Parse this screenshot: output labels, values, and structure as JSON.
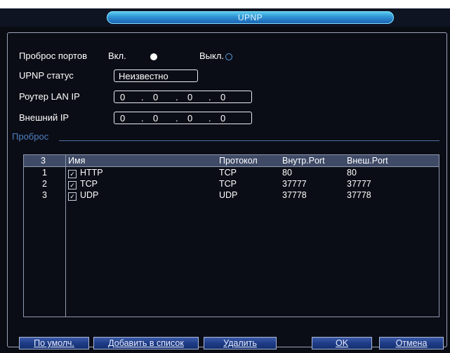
{
  "window": {
    "title": "UPNP"
  },
  "form": {
    "port_forward_label": "Проброс портов",
    "on_label": "Вкл.",
    "off_label": "Выкл.",
    "port_forward_enabled": true,
    "status_label": "UPNP статус",
    "status_value": "Неизвестно",
    "lan_ip_label": "Роутер LAN IP",
    "lan_ip": [
      "0",
      "0",
      "0",
      "0"
    ],
    "wan_ip_label": "Внешний IP",
    "wan_ip": [
      "0",
      "0",
      "0",
      "0"
    ]
  },
  "section_label": "Проброс",
  "table": {
    "count": "3",
    "columns": {
      "name": "Имя",
      "protocol": "Протокол",
      "internal_port": "Внутр.Port",
      "external_port": "Внеш.Port"
    },
    "rows": [
      {
        "index": "1",
        "name": "HTTP",
        "protocol": "TCP",
        "internal_port": "80",
        "external_port": "80",
        "checked": true
      },
      {
        "index": "2",
        "name": "TCP",
        "protocol": "TCP",
        "internal_port": "37777",
        "external_port": "37777",
        "checked": true
      },
      {
        "index": "3",
        "name": "UDP",
        "protocol": "UDP",
        "internal_port": "37778",
        "external_port": "37778",
        "checked": true
      }
    ]
  },
  "buttons": {
    "default": "По умолч.",
    "add": "Добавить в список",
    "delete": "Удалить",
    "ok": "OK",
    "cancel": "Отмена"
  },
  "colors": {
    "background": "#0a0c14",
    "title_accent": "#2f93d3",
    "section_text": "#4f7fbf",
    "button": "#1f3c86"
  }
}
